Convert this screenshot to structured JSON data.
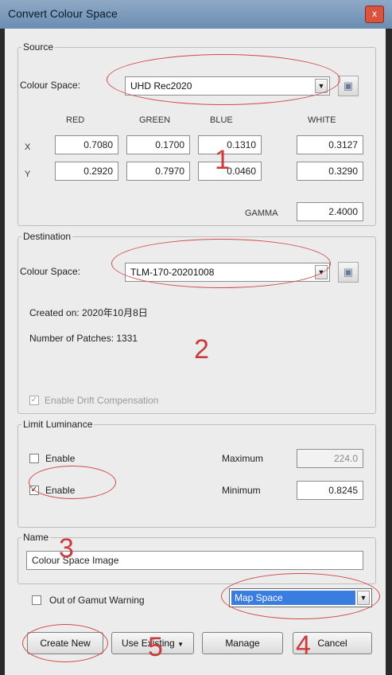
{
  "window": {
    "title": "Convert Colour Space",
    "close_label": "x"
  },
  "source": {
    "legend": "Source",
    "colour_space_label": "Colour Space:",
    "colour_space_value": "UHD Rec2020",
    "col_red": "RED",
    "col_green": "GREEN",
    "col_blue": "BLUE",
    "col_white": "WHITE",
    "row_x": "X",
    "row_y": "Y",
    "x_red": "0.7080",
    "x_green": "0.1700",
    "x_blue": "0.1310",
    "x_white": "0.3127",
    "y_red": "0.2920",
    "y_green": "0.7970",
    "y_blue": "0.0460",
    "y_white": "0.3290",
    "gamma_label": "GAMMA",
    "gamma_value": "2.4000"
  },
  "destination": {
    "legend": "Destination",
    "colour_space_label": "Colour Space:",
    "colour_space_value": "TLM-170-20201008",
    "created_on": "Created on: 2020年10月8日",
    "patches": "Number of Patches: 1331",
    "drift_label": "Enable Drift Compensation"
  },
  "limit": {
    "legend": "Limit Luminance",
    "enable_max_label": "Enable",
    "enable_min_label": "Enable",
    "maximum_label": "Maximum",
    "maximum_value": "224.0",
    "minimum_label": "Minimum",
    "minimum_value": "0.8245"
  },
  "name": {
    "legend": "Name",
    "value": "Colour Space Image"
  },
  "gamut": {
    "label": "Out of Gamut Warning",
    "mode_value": "Map Space"
  },
  "buttons": {
    "create_new": "Create New",
    "use_existing": "Use Existing",
    "manage": "Manage",
    "cancel": "Cancel"
  },
  "annotations": {
    "n1": "1",
    "n2": "2",
    "n3": "3",
    "n4": "4",
    "n5": "5"
  },
  "colors": {
    "annotation_red": "#cc3b3b",
    "selection_blue": "#3a7de0"
  }
}
